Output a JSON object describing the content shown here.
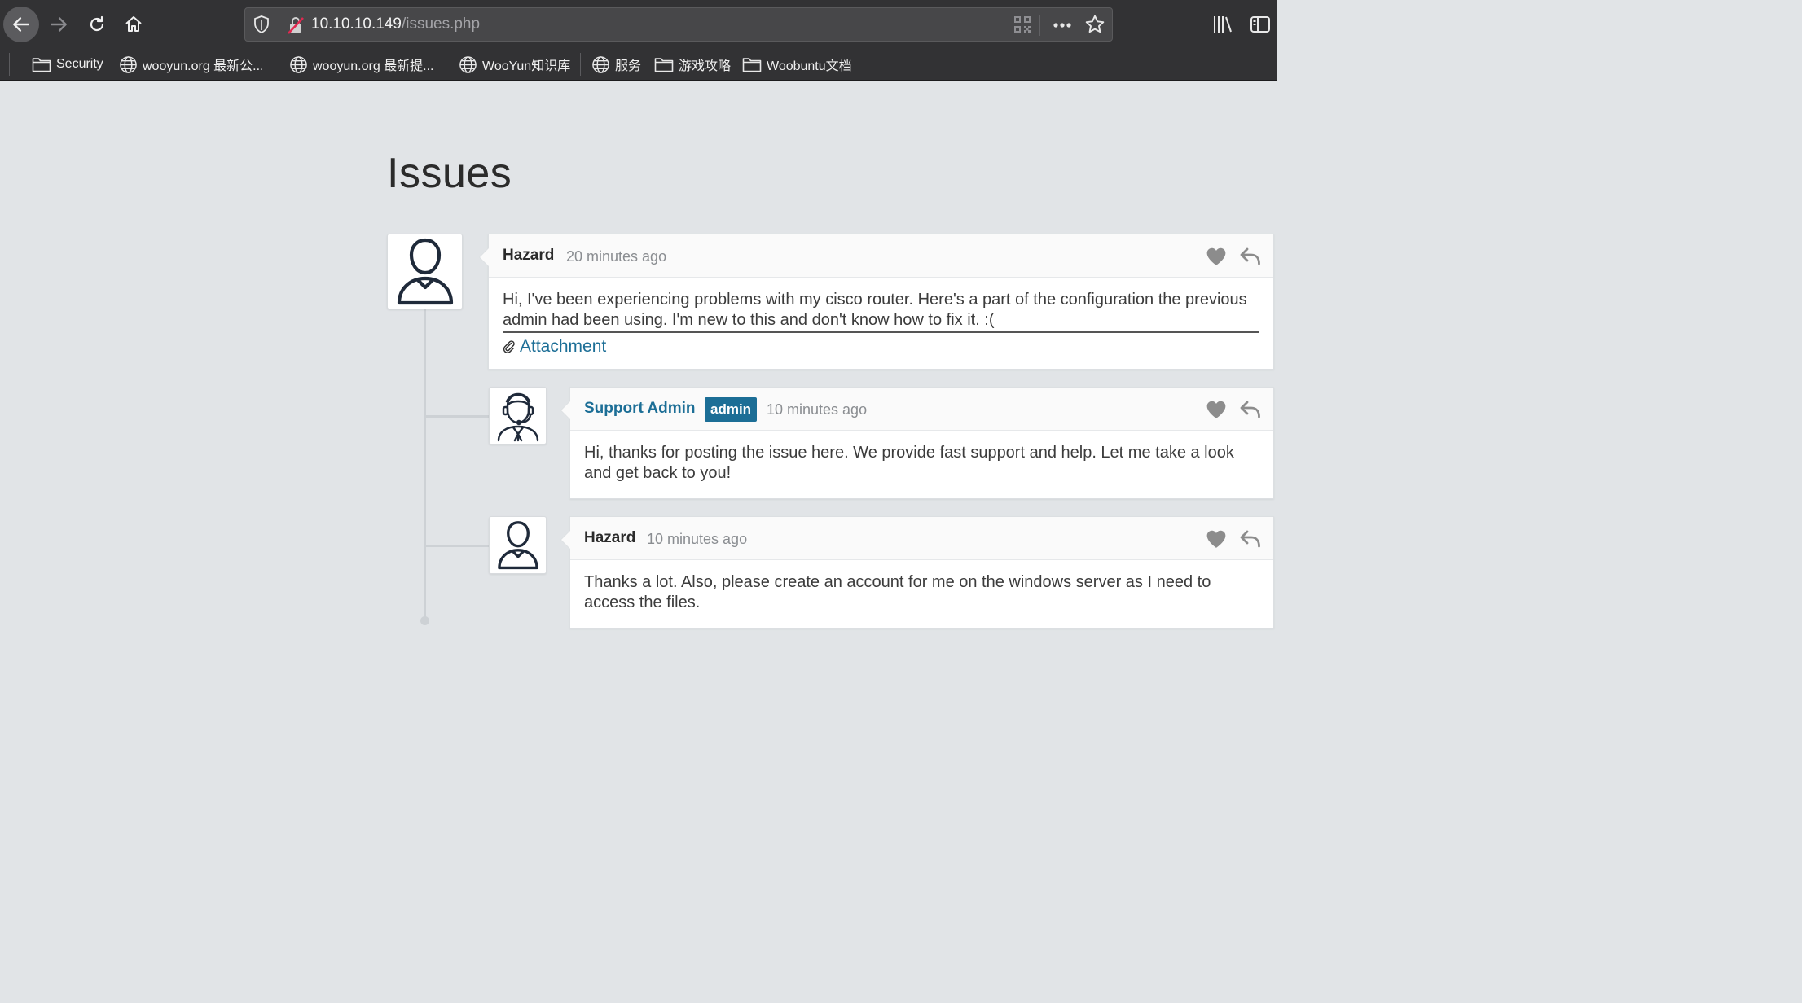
{
  "browser": {
    "url_host": "10.10.10.149",
    "url_path": "/issues.php",
    "bookmarks": [
      {
        "label": "Security",
        "icon": "folder-icon"
      },
      {
        "label": "wooyun.org 最新公...",
        "icon": "globe-icon"
      },
      {
        "label": "wooyun.org 最新提...",
        "icon": "globe-icon"
      },
      {
        "label": "WooYun知识库",
        "icon": "globe-icon"
      },
      {
        "label": "服务",
        "icon": "globe-icon"
      },
      {
        "label": "游戏攻略",
        "icon": "folder-icon"
      },
      {
        "label": "Woobuntu文档",
        "icon": "folder-icon"
      }
    ]
  },
  "page": {
    "title": "Issues"
  },
  "comments": [
    {
      "author": "Hazard",
      "time": "20 minutes ago",
      "text": "Hi, I've been experiencing problems with my cisco router. Here's a part of the configuration the previous admin had been using. I'm new to this and don't know how to fix it. :(",
      "attachment_label": "Attachment",
      "avatar": "user-avatar-icon"
    },
    {
      "author": "Support Admin",
      "badge": "admin",
      "time": "10 minutes ago",
      "text": "Hi, thanks for posting the issue here. We provide fast support and help. Let me take a look and get back to you!",
      "avatar": "support-agent-avatar-icon"
    },
    {
      "author": "Hazard",
      "time": "10 minutes ago",
      "text": "Thanks a lot. Also, please create an account for me on the windows server as I need to access the files.",
      "avatar": "user-avatar-icon"
    }
  ],
  "colors": {
    "accent": "#1c6e96",
    "page_bg": "#e1e4e7",
    "chrome_bg": "#323234"
  }
}
